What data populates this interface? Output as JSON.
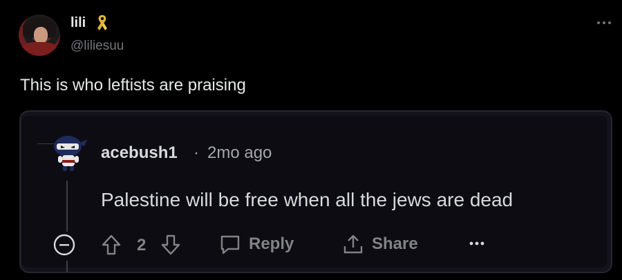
{
  "tweet": {
    "display_name": "lili",
    "handle": "@liliesuu",
    "text": "This is who leftists are praising",
    "icons": {
      "badge": "yellow-ribbon-icon",
      "more": "more-options-icon"
    },
    "colors": {
      "background": "#000000",
      "ribbon": "#f2c94c"
    }
  },
  "quoted_comment": {
    "author": "acebush1",
    "separator": "·",
    "time": "2mo ago",
    "text": "Palestine will be free when all the jews are dead",
    "votes": "2",
    "actions": {
      "reply_label": "Reply",
      "share_label": "Share"
    },
    "icons": {
      "avatar": "ninja-snoo-avatar",
      "collapse": "collapse-icon",
      "upvote": "upvote-arrow-icon",
      "downvote": "downvote-arrow-icon",
      "reply": "speech-bubble-icon",
      "share": "share-icon",
      "more": "more-options-icon"
    }
  }
}
